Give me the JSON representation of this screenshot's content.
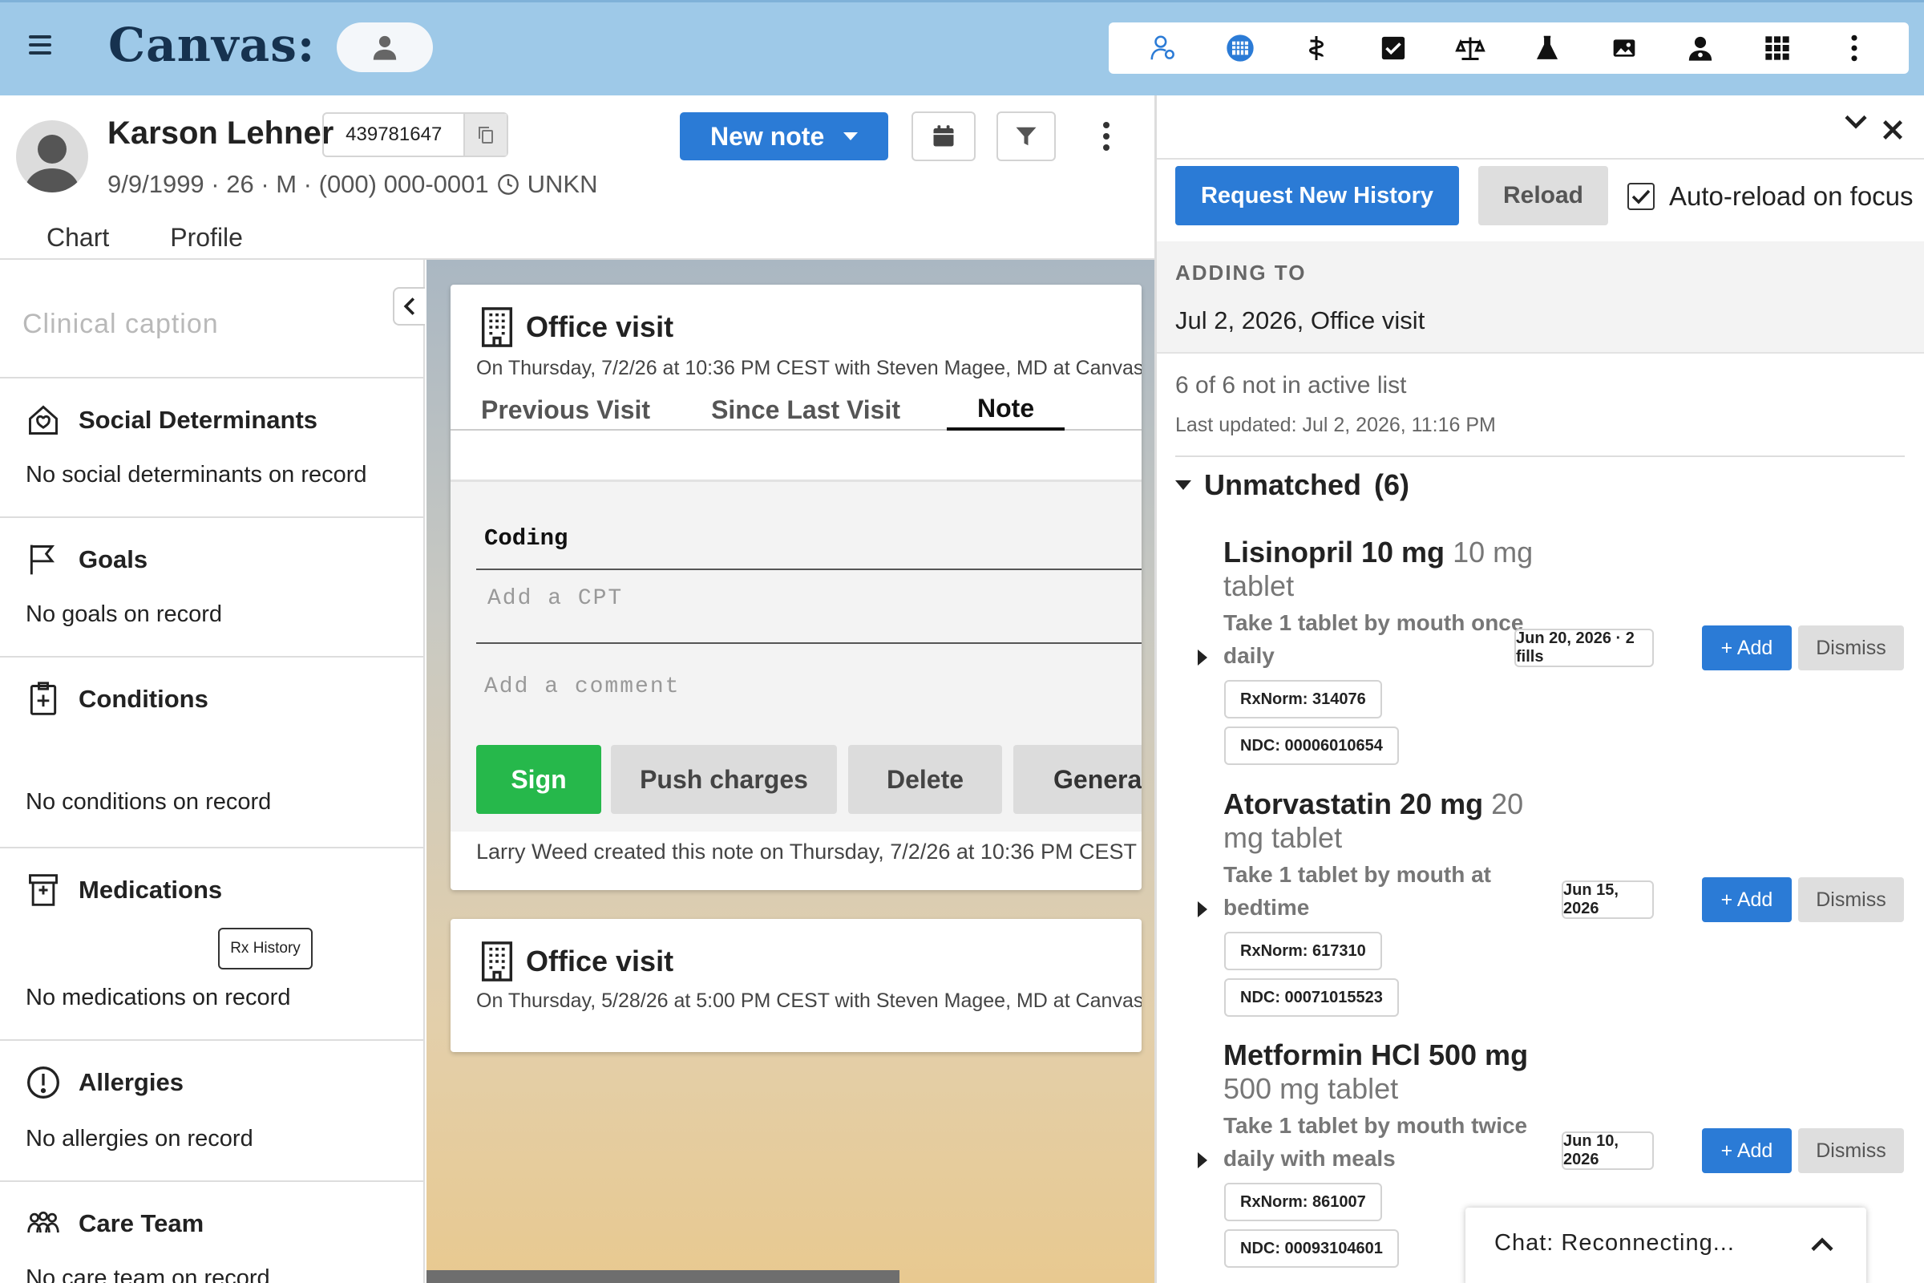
{
  "app": {
    "logo": "Canvas:"
  },
  "toolbar": {
    "icons": [
      "patient-list-icon",
      "schedule-icon",
      "caduceus-icon",
      "tasks-icon",
      "scale-icon",
      "lab-flask-icon",
      "image-icon",
      "provider-icon",
      "apps-grid-icon",
      "more-icon"
    ]
  },
  "patient": {
    "name": "Karson Lehner",
    "id": "439781647",
    "info": "9/9/1999 · 26 · M · (000) 000-0001",
    "timezone": "UNKN"
  },
  "header": {
    "new_note": "New note"
  },
  "tabs": [
    "Chart",
    "Profile"
  ],
  "sidebar": {
    "caption_placeholder": "Clinical caption",
    "sections": [
      {
        "title": "Social Determinants",
        "empty": "No social determinants on record"
      },
      {
        "title": "Goals",
        "empty": "No goals on record"
      },
      {
        "title": "Conditions",
        "empty": "No conditions on record"
      },
      {
        "title": "Medications",
        "empty": "No medications on record",
        "button": "Rx History"
      },
      {
        "title": "Allergies",
        "empty": "No allergies on record"
      },
      {
        "title": "Care Team",
        "empty": "No care team on record"
      }
    ]
  },
  "feed": {
    "note1": {
      "title": "Office visit",
      "subtitle": "On Thursday, 7/2/26 at 10:36 PM CEST with Steven Magee, MD at Canvas",
      "tabs": [
        "Previous Visit",
        "Since Last Visit",
        "Note"
      ],
      "coding_label": "Coding",
      "cpt_placeholder": "Add a CPT",
      "comment_placeholder": "Add a comment",
      "buttons": {
        "sign": "Sign",
        "push": "Push charges",
        "delete": "Delete",
        "generate": "Generat"
      },
      "created": "Larry Weed created this note on Thursday, 7/2/26 at 10:36 PM CEST"
    },
    "note2": {
      "title": "Office visit",
      "subtitle": "On Thursday, 5/28/26 at 5:00 PM CEST with Steven Magee, MD at Canvas"
    }
  },
  "rxpanel": {
    "request_btn": "Request New History",
    "reload_btn": "Reload",
    "autoreload_label": "Auto-reload on focus",
    "autoreload_checked": true,
    "adding_to_label": "ADDING TO",
    "adding_to_value": "Jul 2, 2026, Office visit",
    "not_active": "6 of 6 not in active list",
    "last_updated": "Last updated: Jul 2, 2026, 11:16 PM",
    "unmatched_label": "Unmatched",
    "unmatched_count": "(6)",
    "meds": [
      {
        "name": "Lisinopril 10 mg tablet",
        "strength": "10 mg tablet",
        "sig": "Take 1 tablet by mouth once daily",
        "date": "Jun 20, 2026 · 2 fills",
        "rxnorm": "RxNorm: 314076",
        "ndc": "NDC: 00006010654",
        "add": "+ Add",
        "dismiss": "Dismiss"
      },
      {
        "name": "Atorvastatin 20 mg tablet",
        "strength": "20 mg tablet",
        "sig": "Take 1 tablet by mouth at bedtime",
        "date": "Jun 15, 2026",
        "rxnorm": "RxNorm: 617310",
        "ndc": "NDC: 00071015523",
        "add": "+ Add",
        "dismiss": "Dismiss"
      },
      {
        "name": "Metformin HCl 500 mg tablet",
        "strength": "500 mg tablet",
        "sig": "Take 1 tablet by mouth twice daily with meals",
        "date": "Jun 10, 2026",
        "rxnorm": "RxNorm: 861007",
        "ndc": "NDC: 00093104601",
        "add": "+ Add",
        "dismiss": "Dismiss"
      }
    ]
  },
  "chat": {
    "label": "Chat: Reconnecting..."
  }
}
